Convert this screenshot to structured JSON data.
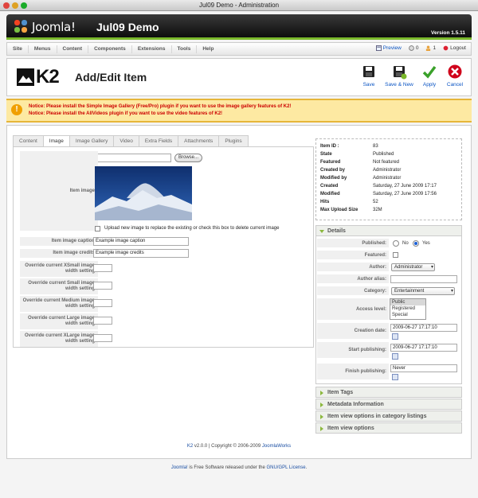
{
  "window": {
    "title": "Jul09 Demo - Administration"
  },
  "header": {
    "logo_text": "Joomla!",
    "site_name": "Jul09 Demo",
    "version": "Version 1.5.11"
  },
  "menu": {
    "items": [
      "Site",
      "Menus",
      "Content",
      "Components",
      "Extensions",
      "Tools",
      "Help"
    ],
    "preview": "Preview",
    "messages_count": "0",
    "users_count": "1",
    "logout": "Logout"
  },
  "toolbar": {
    "logo": "K2",
    "title": "Add/Edit Item",
    "buttons": [
      "Save",
      "Save & New",
      "Apply",
      "Cancel"
    ]
  },
  "notice": {
    "line1": "Notice: Please install the Simple Image Gallery (Free/Pro) plugin if you want to use the image gallery features of K2!",
    "line2": "Notice: Please install the AllVideos plugin if you want to use the video features of K2!"
  },
  "tabs": [
    "Content",
    "Image",
    "Image Gallery",
    "Video",
    "Extra Fields",
    "Attachments",
    "Plugins"
  ],
  "active_tab": "Image",
  "image_tab": {
    "browse": "Browse...",
    "item_image_label": "Item image",
    "upload_note": "Upload new image to replace the existing or check this box to delete current image",
    "caption_label": "Item image caption",
    "caption_value": "Example image caption",
    "credits_label": "Item image credits",
    "credits_value": "Example image credits",
    "override_xsmall": "Override current XSmall image width setting",
    "override_small": "Override current Small image width setting",
    "override_medium": "Override current Medium image width setting",
    "override_large": "Override current Large image width setting",
    "override_xlarge": "Override current XLarge image width setting"
  },
  "meta": {
    "rows": [
      {
        "label": "Item ID :",
        "value": "83"
      },
      {
        "label": "State",
        "value": "Published"
      },
      {
        "label": "Featured",
        "value": "Not featured"
      },
      {
        "label": "Created by",
        "value": "Administrator"
      },
      {
        "label": "Modified by",
        "value": "Administrator"
      },
      {
        "label": "Created",
        "value": "Saturday, 27 June 2009 17:17"
      },
      {
        "label": "Modified",
        "value": "Saturday, 27 June 2009 17:56"
      },
      {
        "label": "Hits",
        "value": "52"
      },
      {
        "label": "Max Upload Size",
        "value": "32M"
      }
    ]
  },
  "details": {
    "heading": "Details",
    "published_label": "Published:",
    "no": "No",
    "yes": "Yes",
    "featured_label": "Featured:",
    "author_label": "Author:",
    "author_value": "Administrator",
    "alias_label": "Author alias:",
    "category_label": "Category:",
    "category_value": "Entertainment",
    "access_label": "Access level:",
    "access_options": [
      "Public",
      "Registered",
      "Special"
    ],
    "creation_label": "Creation date:",
    "creation_value": "2009-06-27 17:17:10",
    "start_label": "Start publishing:",
    "start_value": "2009-06-27 17:17:10",
    "finish_label": "Finish publishing:",
    "finish_value": "Never"
  },
  "sections": [
    "Item Tags",
    "Metadata Information",
    "Item view options in category listings",
    "Item view options"
  ],
  "footer": {
    "k2": "K2",
    "k2_rest": " v2.0.0 | Copyright © 2006-2009 ",
    "joomlaworks": "JoomlaWorks",
    "joomla": "Joomla!",
    "joomla_rest": " is Free Software released under the ",
    "license": "GNU/GPL License",
    "end": "."
  },
  "colors": {
    "accent_green": "#7ab82b",
    "notice_red": "#cc0000",
    "link_blue": "#0b55c4"
  }
}
